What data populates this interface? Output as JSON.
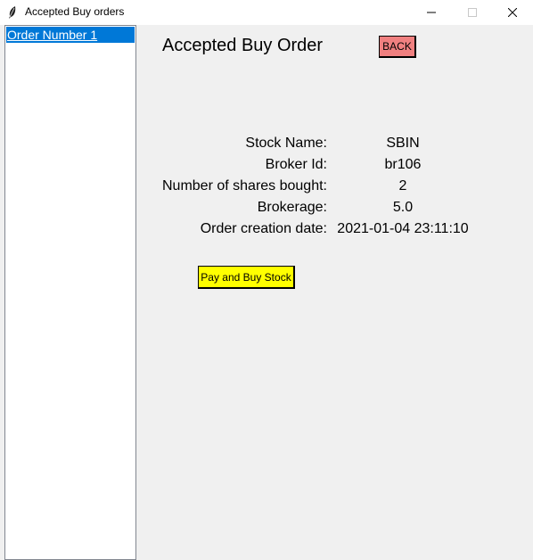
{
  "window": {
    "title": "Accepted Buy orders",
    "icon": "feather-icon"
  },
  "sidebar": {
    "items": [
      {
        "label": "Order Number 1",
        "selected": true
      }
    ]
  },
  "main": {
    "heading": "Accepted Buy Order",
    "back_label": "BACK",
    "pay_label": "Pay and Buy Stock",
    "fields": [
      {
        "label": "Stock Name:",
        "value": "SBIN"
      },
      {
        "label": "Broker Id:",
        "value": "br106"
      },
      {
        "label": "Number of shares bought:",
        "value": "2"
      },
      {
        "label": "Brokerage:",
        "value": "5.0"
      },
      {
        "label": "Order creation date:",
        "value": "2021-01-04 23:11:10"
      }
    ]
  },
  "colors": {
    "selection": "#0078d7",
    "back_button": "#f08080",
    "pay_button": "#ffff00",
    "panel_bg": "#f0f0f0"
  }
}
